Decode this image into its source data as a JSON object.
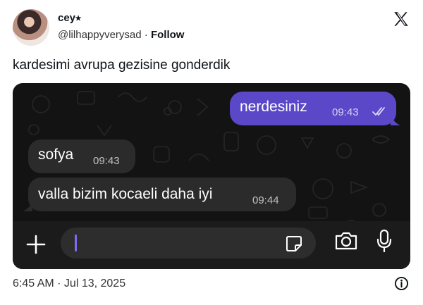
{
  "author": {
    "display_name": "cey⭑",
    "handle": "@lilhappyverysad",
    "separator": " · ",
    "follow_label": "Follow"
  },
  "tweet": {
    "text": "kardesimi avrupa gezisine gonderdik",
    "timestamp": "6:45 AM · Jul 13, 2025"
  },
  "chat": {
    "messages": [
      {
        "direction": "outgoing",
        "text": "nerdesiniz",
        "time": "09:43",
        "status": "read"
      },
      {
        "direction": "incoming",
        "text": "sofya",
        "time": "09:43"
      },
      {
        "direction": "incoming",
        "text": "valla bizim kocaeli daha iyi",
        "time": "09:44"
      }
    ],
    "composer": {
      "placeholder": ""
    }
  },
  "colors": {
    "outgoing_bubble": "#5b48c9",
    "incoming_bubble": "#2b2b2b",
    "chat_background": "#131313",
    "composer_bar": "#1b1b1b",
    "caret": "#7b6cf0"
  },
  "icons": [
    "x-logo-icon",
    "plus-icon",
    "sticker-icon",
    "camera-icon",
    "microphone-icon",
    "info-icon",
    "double-check-icon"
  ]
}
